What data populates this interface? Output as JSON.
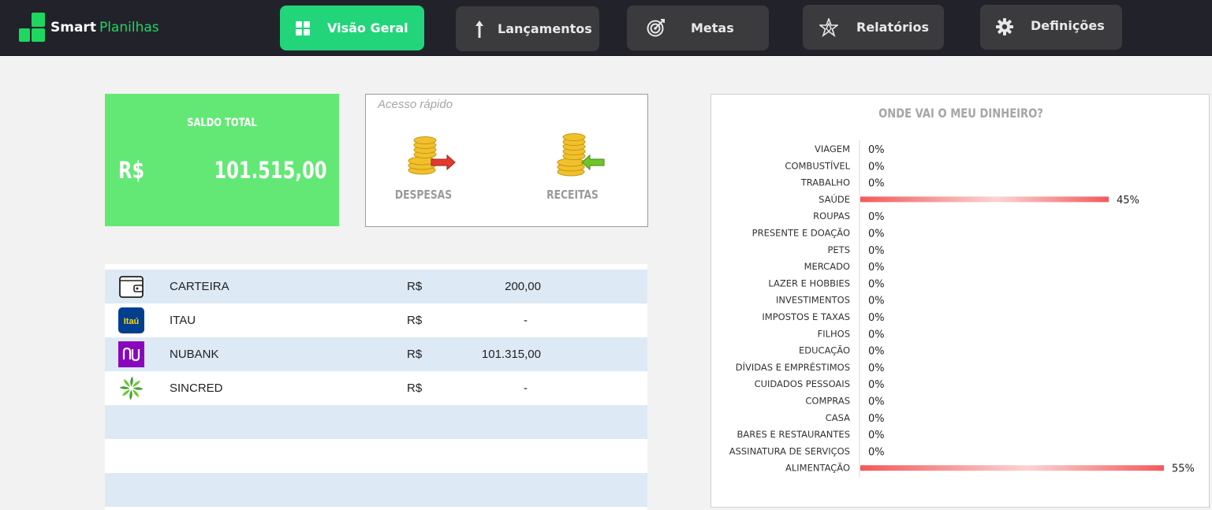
{
  "header": {
    "brand_first": "Smart",
    "brand_second": "Planilhas",
    "nav": [
      {
        "label": "Visão Geral",
        "icon": "grid-icon",
        "active": true
      },
      {
        "label": "Lançamentos",
        "icon": "pin-icon",
        "active": false
      },
      {
        "label": "Metas",
        "icon": "target-icon",
        "active": false
      },
      {
        "label": "Relatórios",
        "icon": "star-chart-icon",
        "active": false
      },
      {
        "label": "Definições",
        "icon": "gear-icon",
        "active": false
      }
    ]
  },
  "saldo": {
    "title": "SALDO TOTAL",
    "currency": "R$",
    "value": "101.515,00"
  },
  "quick_access": {
    "title": "Acesso rápido",
    "despesas": "DESPESAS",
    "receitas": "RECEITAS"
  },
  "accounts": [
    {
      "name": "CARTEIRA",
      "currency": "R$",
      "amount": "200,00",
      "icon": "wallet-icon"
    },
    {
      "name": "ITAU",
      "currency": "R$",
      "amount": "-",
      "icon": "itau-logo-icon",
      "icon_text": "Itaú"
    },
    {
      "name": "NUBANK",
      "currency": "R$",
      "amount": "101.315,00",
      "icon": "nubank-logo-icon"
    },
    {
      "name": "SINCRED",
      "currency": "R$",
      "amount": "-",
      "icon": "sicredi-logo-icon"
    }
  ],
  "colors": {
    "brand_green": "#1ed760",
    "nav_active": "#23d57a",
    "saldo_green": "#63e876",
    "bar_red": "#f25a5a",
    "row_alt": "#dde9f5"
  },
  "chart_data": {
    "type": "bar",
    "orientation": "horizontal",
    "title": "ONDE VAI O MEU DINHEIRO?",
    "categories": [
      "VIAGEM",
      "COMBUSTÍVEL",
      "TRABALHO",
      "SAÚDE",
      "ROUPAS",
      "PRESENTE E DOAÇÃO",
      "PETS",
      "MERCADO",
      "LAZER E HOBBIES",
      "INVESTIMENTOS",
      "IMPOSTOS E TAXAS",
      "FILHOS",
      "EDUCAÇÃO",
      "DÍVIDAS E EMPRÉSTIMOS",
      "CUIDADOS PESSOAIS",
      "COMPRAS",
      "CASA",
      "BARES E RESTAURANTES",
      "ASSINATURA DE SERVIÇOS",
      "ALIMENTAÇÃO"
    ],
    "values": [
      0,
      0,
      0,
      45,
      0,
      0,
      0,
      0,
      0,
      0,
      0,
      0,
      0,
      0,
      0,
      0,
      0,
      0,
      0,
      55
    ],
    "labels": [
      "0%",
      "0%",
      "0%",
      "45%",
      "0%",
      "0%",
      "0%",
      "0%",
      "0%",
      "0%",
      "0%",
      "0%",
      "0%",
      "0%",
      "0%",
      "0%",
      "0%",
      "0%",
      "0%",
      "55%"
    ],
    "value_unit": "%",
    "xlim": [
      0,
      60
    ],
    "grid": false,
    "legend": "none"
  }
}
